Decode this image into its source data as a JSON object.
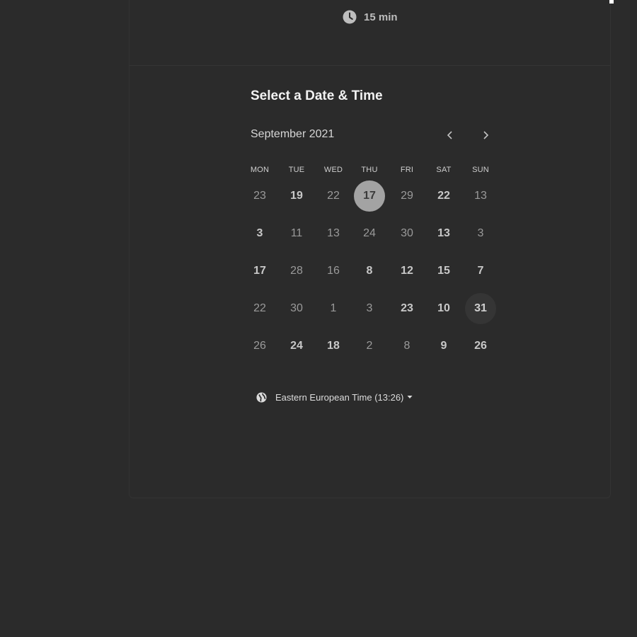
{
  "header": {
    "duration": "15 min"
  },
  "calendar": {
    "title": "Select a Date & Time",
    "month": "September 2021",
    "weekdays": [
      "MON",
      "TUE",
      "WED",
      "THU",
      "FRI",
      "SAT",
      "SUN"
    ],
    "weeks": [
      [
        {
          "d": "23",
          "s": "plain"
        },
        {
          "d": "19",
          "s": "bold"
        },
        {
          "d": "22",
          "s": "plain"
        },
        {
          "d": "17",
          "s": "selected"
        },
        {
          "d": "29",
          "s": "plain"
        },
        {
          "d": "22",
          "s": "bold"
        },
        {
          "d": "13",
          "s": "plain"
        }
      ],
      [
        {
          "d": "3",
          "s": "bold"
        },
        {
          "d": "11",
          "s": "plain"
        },
        {
          "d": "13",
          "s": "plain"
        },
        {
          "d": "24",
          "s": "plain"
        },
        {
          "d": "30",
          "s": "plain"
        },
        {
          "d": "13",
          "s": "bold"
        },
        {
          "d": "3",
          "s": "plain"
        }
      ],
      [
        {
          "d": "17",
          "s": "bold"
        },
        {
          "d": "28",
          "s": "plain"
        },
        {
          "d": "16",
          "s": "plain"
        },
        {
          "d": "8",
          "s": "bold"
        },
        {
          "d": "12",
          "s": "bold"
        },
        {
          "d": "15",
          "s": "bold"
        },
        {
          "d": "7",
          "s": "bold"
        }
      ],
      [
        {
          "d": "22",
          "s": "plain"
        },
        {
          "d": "30",
          "s": "plain"
        },
        {
          "d": "1",
          "s": "plain"
        },
        {
          "d": "3",
          "s": "plain"
        },
        {
          "d": "23",
          "s": "bold"
        },
        {
          "d": "10",
          "s": "bold"
        },
        {
          "d": "31",
          "s": "hover"
        }
      ],
      [
        {
          "d": "26",
          "s": "plain"
        },
        {
          "d": "24",
          "s": "bold"
        },
        {
          "d": "18",
          "s": "bold"
        },
        {
          "d": "2",
          "s": "plain"
        },
        {
          "d": "8",
          "s": "plain"
        },
        {
          "d": "9",
          "s": "bold"
        },
        {
          "d": "26",
          "s": "bold"
        }
      ]
    ]
  },
  "timezone": {
    "label": "Eastern European Time (13:26)"
  },
  "icons": {
    "duration": "clock-icon",
    "prev": "chevron-left-icon",
    "next": "chevron-right-icon",
    "timezone": "globe-icon",
    "dropdown": "caret-down-icon"
  },
  "colors": {
    "background": "#2b2b2b",
    "selected_day": "#a3a3a3",
    "hover_day": "#353535"
  }
}
